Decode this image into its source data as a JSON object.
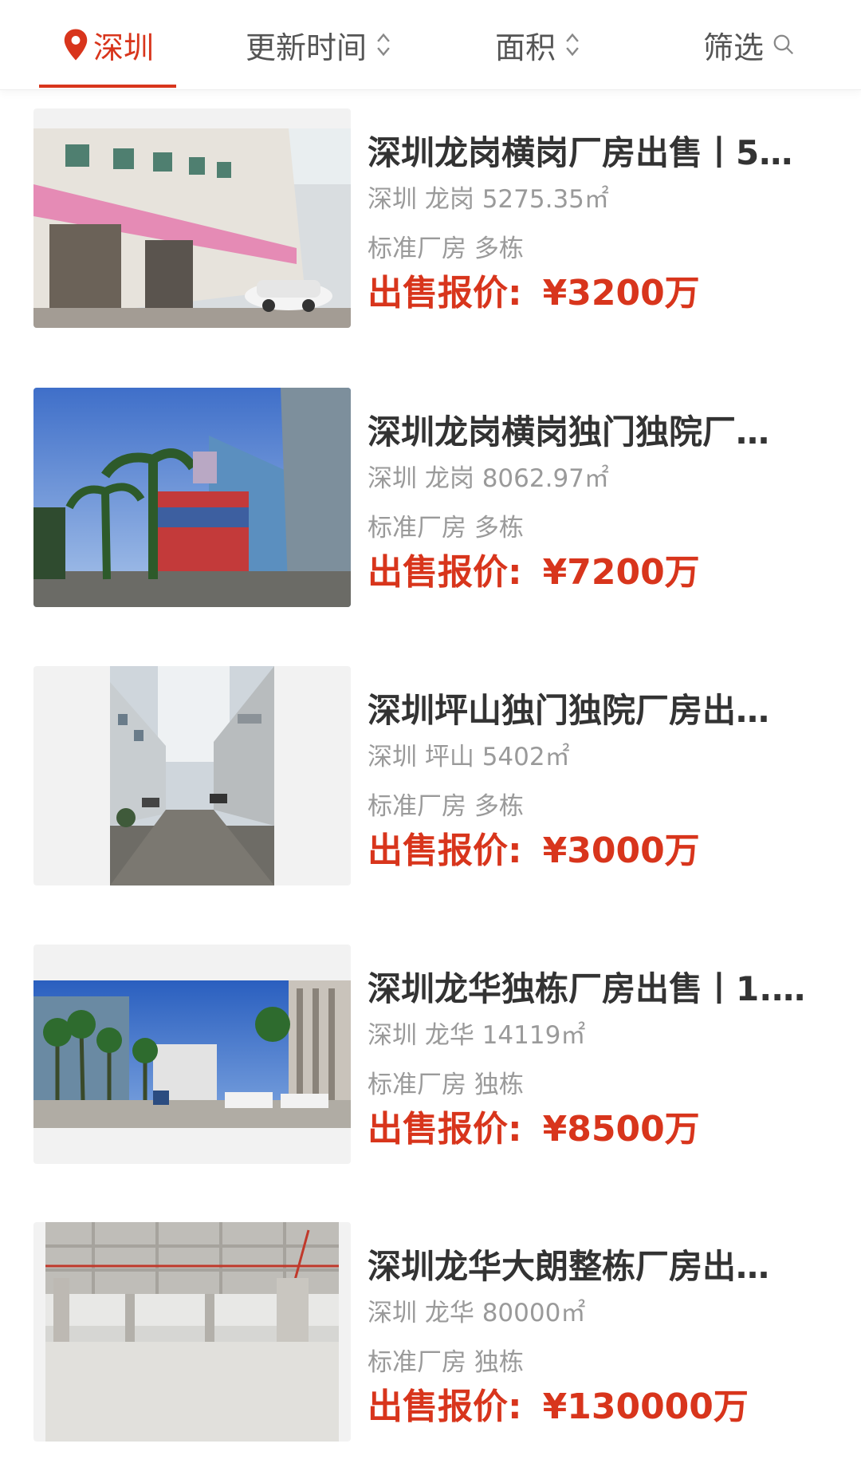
{
  "filters": {
    "city": "深圳",
    "sort_updated": "更新时间",
    "sort_area": "面积",
    "filter": "筛选"
  },
  "colors": {
    "accent": "#d8351c",
    "title": "#333333",
    "meta": "#9a9a9a"
  },
  "listings": [
    {
      "title": "深圳龙岗横岗厂房出售丨5…",
      "location": "深圳 龙岗 5275.35㎡",
      "tags": "标准厂房 多栋",
      "price_label": "出售报价:",
      "price": "¥3200万"
    },
    {
      "title": "深圳龙岗横岗独门独院厂…",
      "location": "深圳 龙岗 8062.97㎡",
      "tags": "标准厂房 多栋",
      "price_label": "出售报价:",
      "price": "¥7200万"
    },
    {
      "title": "深圳坪山独门独院厂房出…",
      "location": "深圳 坪山 5402㎡",
      "tags": "标准厂房 多栋",
      "price_label": "出售报价:",
      "price": "¥3000万"
    },
    {
      "title": "深圳龙华独栋厂房出售丨1.…",
      "location": "深圳 龙华 14119㎡",
      "tags": "标准厂房 独栋",
      "price_label": "出售报价:",
      "price": "¥8500万"
    },
    {
      "title": "深圳龙华大朗整栋厂房出…",
      "location": "深圳 龙华 80000㎡",
      "tags": "标准厂房 独栋",
      "price_label": "出售报价:",
      "price": "¥130000万"
    }
  ]
}
